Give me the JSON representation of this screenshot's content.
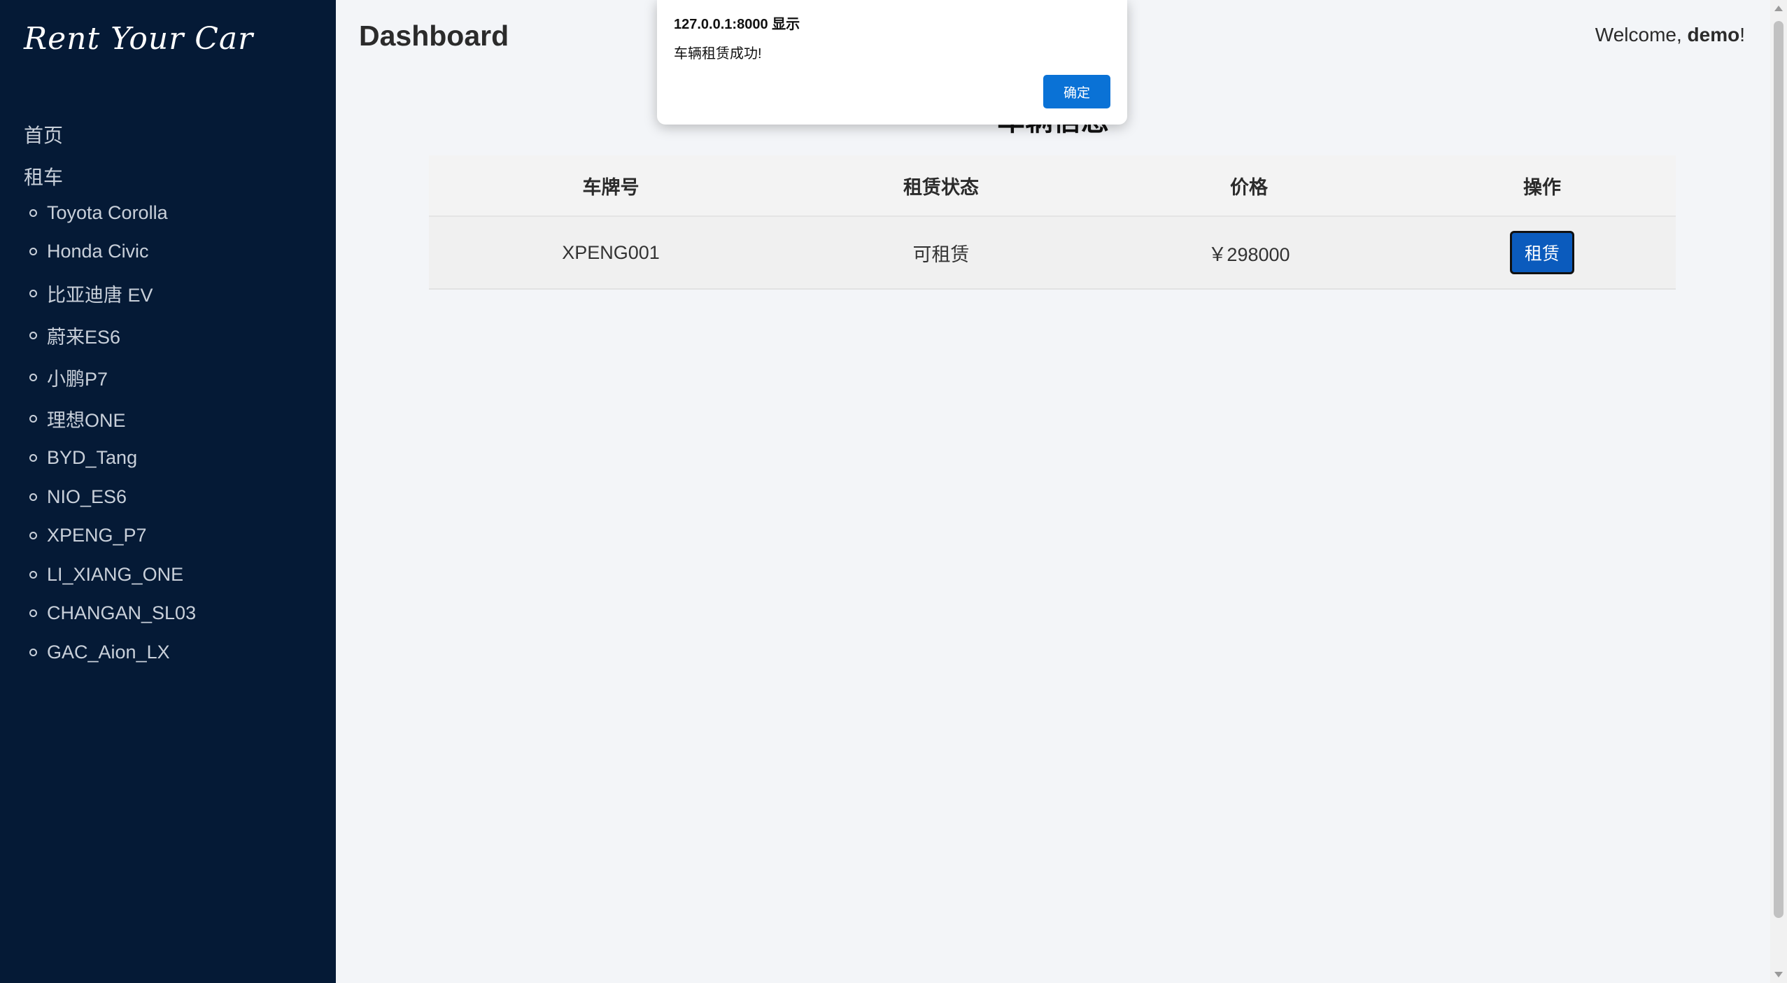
{
  "sidebar": {
    "brand": "Rent Your Car",
    "nav": [
      {
        "label": "首页"
      },
      {
        "label": "租车"
      }
    ],
    "cars": [
      "Toyota Corolla",
      "Honda Civic",
      "比亚迪唐 EV",
      "蔚来ES6",
      "小鹏P7",
      "理想ONE",
      "BYD_Tang",
      "NIO_ES6",
      "XPENG_P7",
      "LI_XIANG_ONE",
      "CHANGAN_SL03",
      "GAC_Aion_LX"
    ]
  },
  "header": {
    "title": "Dashboard",
    "welcome_prefix": "Welcome, ",
    "username": "demo",
    "welcome_suffix": "!"
  },
  "section": {
    "title": "车辆信息"
  },
  "table": {
    "headers": [
      "车牌号",
      "租赁状态",
      "价格",
      "操作"
    ],
    "rows": [
      {
        "plate": "XPENG001",
        "status": "可租赁",
        "price": "￥298000",
        "action": "租赁"
      }
    ]
  },
  "dialog": {
    "title": "127.0.0.1:8000 显示",
    "message": "车辆租赁成功!",
    "ok_label": "确定"
  },
  "colors": {
    "sidebar_bg": "#051a36",
    "primary_button": "#0b5bbd",
    "dialog_button": "#0a72d6"
  }
}
